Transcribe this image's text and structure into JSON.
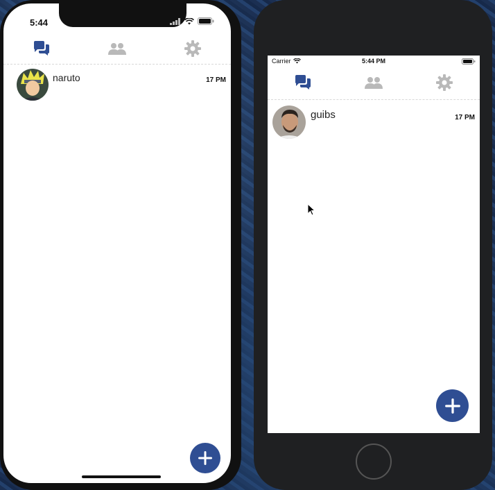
{
  "colors": {
    "accent": "#2f4e93",
    "inactive": "#b9b9b9"
  },
  "phone_left": {
    "status_time": "5:44",
    "tabs": [
      {
        "icon": "chat-icon",
        "active": true
      },
      {
        "icon": "contacts-icon",
        "active": false
      },
      {
        "icon": "settings-gear-icon",
        "active": false
      }
    ],
    "conversation": {
      "name": "naruto",
      "time": "17 PM"
    },
    "fab_icon": "plus-icon"
  },
  "phone_right": {
    "carrier": "Carrier",
    "status_time": "5:44 PM",
    "tabs": [
      {
        "icon": "chat-icon",
        "active": true
      },
      {
        "icon": "contacts-icon",
        "active": false
      },
      {
        "icon": "settings-gear-icon",
        "active": false
      }
    ],
    "conversation": {
      "name": "guibs",
      "time": "17 PM"
    },
    "fab_icon": "plus-icon"
  }
}
